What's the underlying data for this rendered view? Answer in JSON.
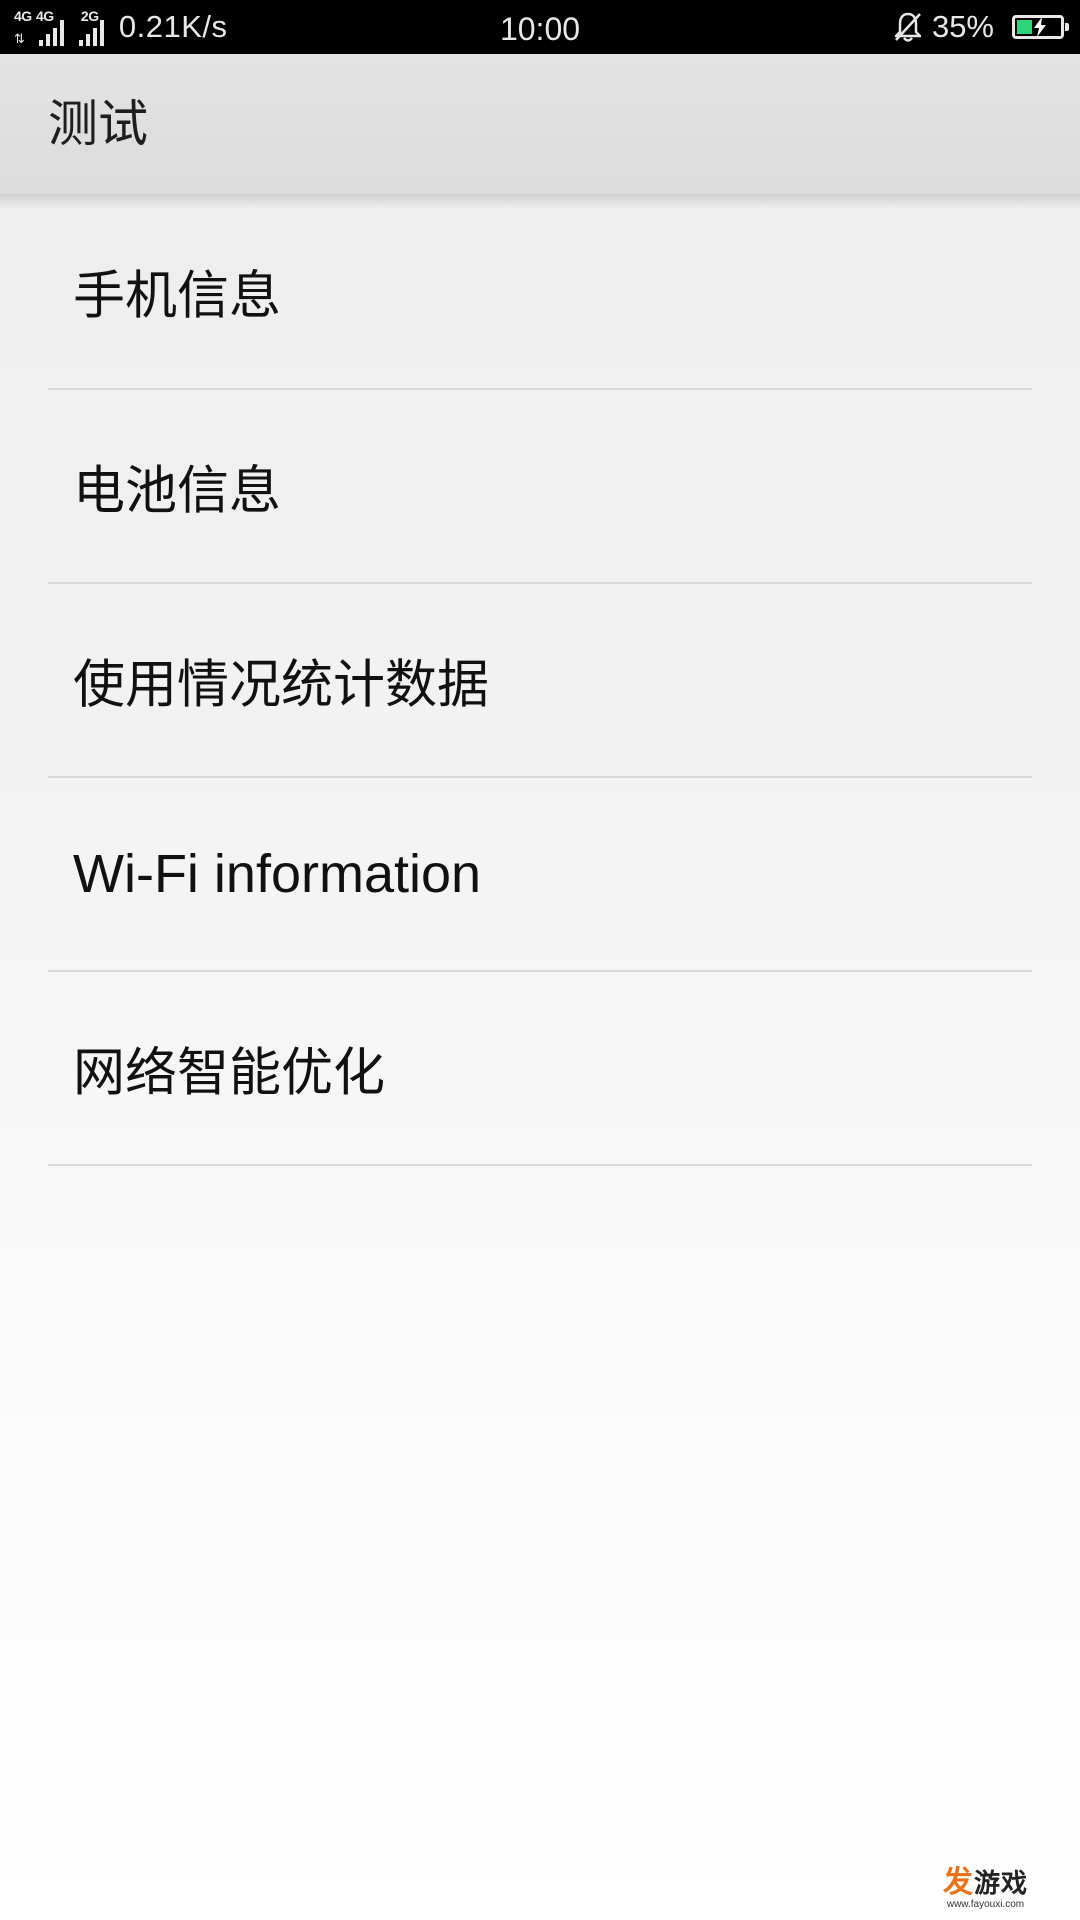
{
  "status_bar": {
    "network_1_label": "4G",
    "network_2_label": "4G",
    "network_3_label": "2G",
    "data_arrows": "⇅",
    "net_speed": "0.21K/s",
    "time": "10:00",
    "battery_percent": "35%",
    "battery_level": 0.35,
    "battery_color": "#2ed37a",
    "icons": [
      "signal-icon",
      "bell-muted-icon",
      "battery-charging-icon"
    ]
  },
  "action_bar": {
    "title": "测试"
  },
  "list": {
    "items": [
      {
        "label": "手机信息"
      },
      {
        "label": "电池信息"
      },
      {
        "label": "使用情况统计数据"
      },
      {
        "label": "Wi-Fi information"
      },
      {
        "label": "网络智能优化"
      }
    ]
  },
  "watermark": {
    "logo_first": "发",
    "logo_rest": "游戏",
    "url": "www.fayouxi.com"
  }
}
